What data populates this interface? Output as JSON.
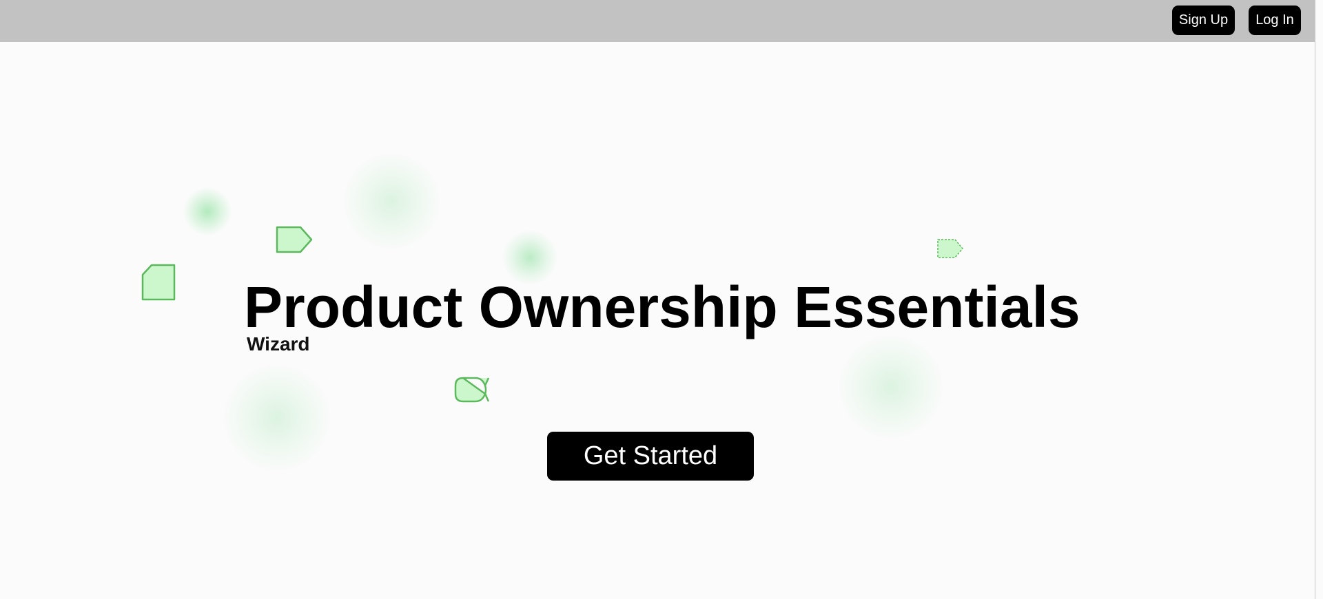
{
  "header": {
    "signup_label": "Sign Up",
    "login_label": "Log In"
  },
  "hero": {
    "title": "Product Ownership Essentials",
    "subtitle": "Wizard",
    "cta_label": "Get Started"
  },
  "colors": {
    "header_background": "#c2c2c2",
    "page_background": "#fbfbfb",
    "button_background": "#000000",
    "button_text": "#ffffff",
    "shape_fill": "#ccf7cc",
    "shape_stroke": "#5cb85c"
  },
  "decorations": [
    "pentagon-tag-shape",
    "clipped-corner-square-shape",
    "dashed-tag-shape",
    "rounded-fish-shape"
  ]
}
